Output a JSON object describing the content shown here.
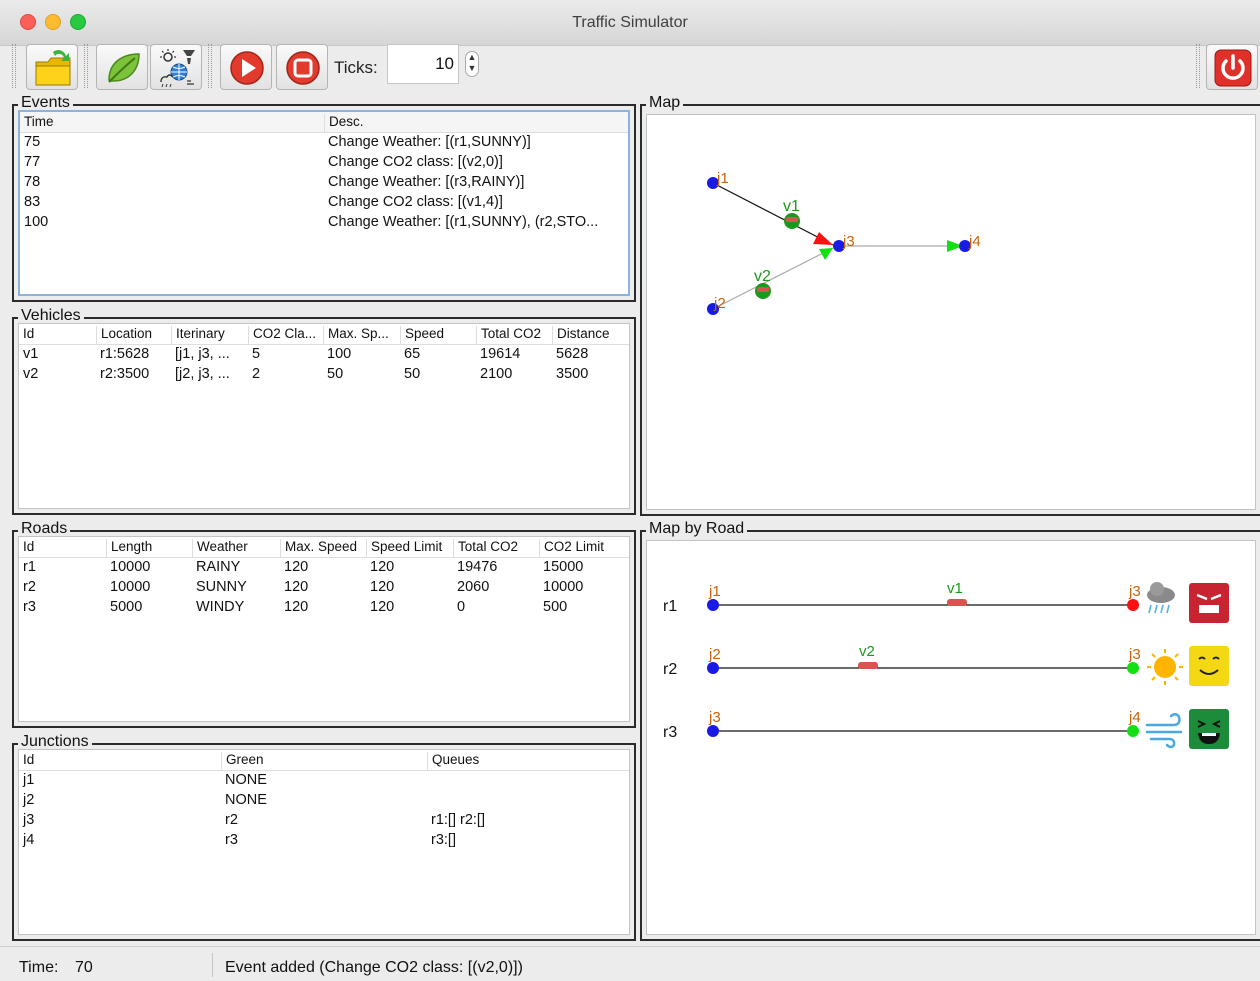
{
  "window": {
    "title": "Traffic Simulator"
  },
  "toolbar": {
    "ticks_label": "Ticks:",
    "ticks_value": "10",
    "buttons": [
      "open-folder",
      "change-co2-class",
      "change-weather",
      "run",
      "stop",
      "exit"
    ]
  },
  "events": {
    "title": "Events",
    "columns": [
      "Time",
      "Desc."
    ],
    "rows": [
      [
        "75",
        "Change Weather: [(r1,SUNNY)]"
      ],
      [
        "77",
        "Change CO2 class: [(v2,0)]"
      ],
      [
        "78",
        "Change Weather: [(r3,RAINY)]"
      ],
      [
        "83",
        "Change CO2 class: [(v1,4)]"
      ],
      [
        "100",
        "Change Weather: [(r1,SUNNY), (r2,STO..."
      ]
    ]
  },
  "vehicles": {
    "title": "Vehicles",
    "columns": [
      "Id",
      "Location",
      "Iterinary",
      "CO2 Cla...",
      "Max. Sp...",
      "Speed",
      "Total CO2",
      "Distance"
    ],
    "rows": [
      [
        "v1",
        "r1:5628",
        "[j1, j3, ...",
        "5",
        "100",
        "65",
        "19614",
        "5628"
      ],
      [
        "v2",
        "r2:3500",
        "[j2, j3, ...",
        "2",
        "50",
        "50",
        "2100",
        "3500"
      ]
    ]
  },
  "roads": {
    "title": "Roads",
    "columns": [
      "Id",
      "Length",
      "Weather",
      "Max. Speed",
      "Speed Limit",
      "Total CO2",
      "CO2 Limit"
    ],
    "rows": [
      [
        "r1",
        "10000",
        "RAINY",
        "120",
        "120",
        "19476",
        "15000"
      ],
      [
        "r2",
        "10000",
        "SUNNY",
        "120",
        "120",
        "2060",
        "10000"
      ],
      [
        "r3",
        "5000",
        "WINDY",
        "120",
        "120",
        "0",
        "500"
      ]
    ]
  },
  "junctions": {
    "title": "Junctions",
    "columns": [
      "Id",
      "Green",
      "Queues"
    ],
    "rows": [
      [
        "j1",
        "NONE",
        ""
      ],
      [
        "j2",
        "NONE",
        ""
      ],
      [
        "j3",
        "r2",
        "r1:[] r2:[]"
      ],
      [
        "j4",
        "r3",
        "r3:[]"
      ]
    ]
  },
  "map": {
    "title": "Map",
    "junction_labels": [
      "j1",
      "j2",
      "j3",
      "j4"
    ],
    "vehicle_labels": [
      "v1",
      "v2"
    ]
  },
  "map_by_road": {
    "title": "Map by Road",
    "roads": [
      {
        "id": "r1",
        "src": "j1",
        "dest": "j3",
        "vehicle": "v1",
        "vehicle_progress": 0.58,
        "dest_light": "red",
        "weather_icon": "rain-cloud-icon",
        "co2_icon": "angry-face-icon"
      },
      {
        "id": "r2",
        "src": "j2",
        "dest": "j3",
        "vehicle": "v2",
        "vehicle_progress": 0.37,
        "dest_light": "green",
        "weather_icon": "sun-icon",
        "co2_icon": "smiley-face-icon"
      },
      {
        "id": "r3",
        "src": "j3",
        "dest": "j4",
        "vehicle": "",
        "dest_light": "green",
        "weather_icon": "wind-icon",
        "co2_icon": "laughing-face-icon"
      }
    ]
  },
  "status": {
    "time_label": "Time:",
    "time_value": "70",
    "message": "Event added (Change CO2 class: [(v2,0)])"
  },
  "colors": {
    "junction": "#1a1ae6",
    "label_orange": "#c8640a",
    "vehicle_green": "#1a9a1a",
    "light_red": "#ff1010",
    "light_green": "#12e012"
  }
}
